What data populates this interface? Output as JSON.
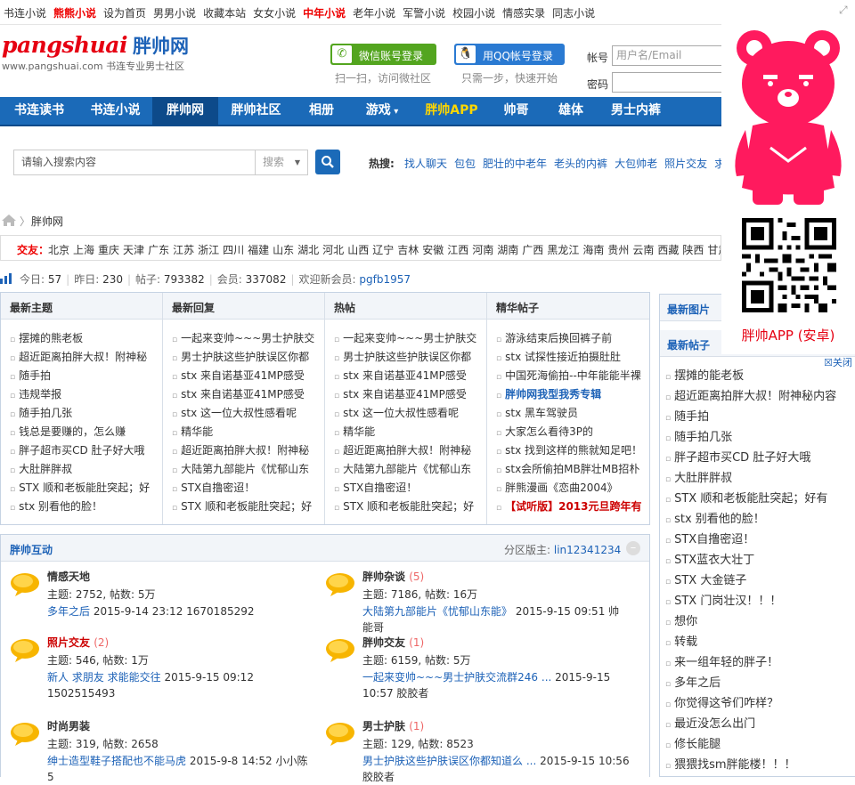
{
  "topbar": {
    "links": [
      {
        "label": "书连小说",
        "hot": false
      },
      {
        "label": "熊熊小说",
        "hot": true
      },
      {
        "label": "设为首页",
        "hot": false
      },
      {
        "label": "男男小说",
        "hot": false
      },
      {
        "label": "收藏本站",
        "hot": false
      },
      {
        "label": "女女小说",
        "hot": false
      },
      {
        "label": "中年小说",
        "hot": true
      },
      {
        "label": "老年小说",
        "hot": false
      },
      {
        "label": "军警小说",
        "hot": false
      },
      {
        "label": "校园小说",
        "hot": false
      },
      {
        "label": "情感实录",
        "hot": false
      },
      {
        "label": "同志小说",
        "hot": false
      }
    ]
  },
  "logo": {
    "brand": "pangshuai",
    "cn": "胖帅网",
    "sub": "www.pangshuai.com  书连专业男士社区"
  },
  "login": {
    "wechat_label": "微信账号登录",
    "wechat_hint": "扫一扫，访问微社区",
    "qq_label": "用QQ帐号登录",
    "qq_hint": "只需一步，快速开始",
    "account_label": "帐号",
    "password_label": "密码",
    "account_placeholder": "用户名/Email"
  },
  "nav": [
    "书连读书",
    "书连小说",
    "胖帅网",
    "胖帅社区",
    "相册",
    "游戏",
    "胖帅APP",
    "帅哥",
    "雄体",
    "男士内裤"
  ],
  "search": {
    "placeholder": "请输入搜索内容",
    "type": "搜索",
    "hot_label": "热搜:",
    "hot": [
      "找人聊天",
      "包包",
      "肥壮的中老年",
      "老头的内裤",
      "大包帅老",
      "照片交友",
      "求"
    ]
  },
  "breadcrumb": "胖帅网",
  "areas": {
    "label": "交友：",
    "list": [
      "北京",
      "上海",
      "重庆",
      "天津",
      "广东",
      "江苏",
      "浙江",
      "四川",
      "福建",
      "山东",
      "湖北",
      "河北",
      "山西",
      "辽宁",
      "吉林",
      "安徽",
      "江西",
      "河南",
      "湖南",
      "广西",
      "黑龙江",
      "海南",
      "贵州",
      "云南",
      "西藏",
      "陕西",
      "甘肃"
    ]
  },
  "stats": {
    "today_label": "今日:",
    "today": "57",
    "yesterday_label": "昨日:",
    "yesterday": "230",
    "posts_label": "帖子:",
    "posts": "793382",
    "members_label": "会员:",
    "members": "337082",
    "welcome": "欢迎新会员:",
    "newest": "pgfb1957"
  },
  "columns": [
    {
      "title": "最新主题",
      "items": [
        {
          "t": "摆摊的熊老板"
        },
        {
          "t": "超近距离拍胖大叔！附神秘"
        },
        {
          "t": "随手拍"
        },
        {
          "t": "违规举报"
        },
        {
          "t": "随手拍几张"
        },
        {
          "t": "钱总是要赚的，怎么赚"
        },
        {
          "t": "胖子超市买CD 肚子好大哦"
        },
        {
          "t": "大肚胖胖叔"
        },
        {
          "t": "STX 顺和老板能肚突起；好"
        },
        {
          "t": "stx 别看他的脸！"
        }
      ]
    },
    {
      "title": "最新回复",
      "items": [
        {
          "t": "一起来变帅~~~男士护肤交"
        },
        {
          "t": "男士护肤这些护肤误区你都"
        },
        {
          "t": "stx 来自诺基亚41MP感受"
        },
        {
          "t": "stx 来自诺基亚41MP感受"
        },
        {
          "t": "stx 这一位大叔性感看呢"
        },
        {
          "t": "精华能"
        },
        {
          "t": "超近距离拍胖大叔！附神秘"
        },
        {
          "t": "大陆第九部能片《忧郁山东"
        },
        {
          "t": "STX自撸密迢！"
        },
        {
          "t": "STX 顺和老板能肚突起；好"
        }
      ]
    },
    {
      "title": "热帖",
      "items": [
        {
          "t": "一起来变帅~~~男士护肤交"
        },
        {
          "t": "男士护肤这些护肤误区你都"
        },
        {
          "t": "stx 来自诺基亚41MP感受"
        },
        {
          "t": "stx 来自诺基亚41MP感受"
        },
        {
          "t": "stx 这一位大叔性感看呢"
        },
        {
          "t": "精华能"
        },
        {
          "t": "超近距离拍胖大叔！附神秘"
        },
        {
          "t": "大陆第九部能片《忧郁山东"
        },
        {
          "t": "STX自撸密迢！"
        },
        {
          "t": "STX 顺和老板能肚突起；好"
        }
      ]
    },
    {
      "title": "精华帖子",
      "items": [
        {
          "t": "游泳结束后换回裤子前"
        },
        {
          "t": "stx 试探性接近拍摄肚肚"
        },
        {
          "t": "中国死海偷拍--中年能能半裸"
        },
        {
          "t": "胖帅网我型我秀专辑",
          "style": "blue"
        },
        {
          "t": "stx 黑车驾驶员"
        },
        {
          "t": "大家怎么看待3P的"
        },
        {
          "t": "stx 找到这样的熊就知足吧！"
        },
        {
          "t": "stx会所偷拍MB胖壮MB招朴"
        },
        {
          "t": "胖熊漫画《恋曲2004》"
        },
        {
          "t": "【试听版】2013元旦跨年有",
          "style": "red"
        }
      ]
    }
  ],
  "forum": {
    "title": "胖帅互动",
    "mod_label": "分区版主:",
    "mod": "lin12341234",
    "boards": [
      {
        "name": "情感天地",
        "new": "",
        "stat": "主题: 2752, 帖数: 5万",
        "last_link": "多年之后",
        "last_info": " 2015-9-14 23:12 1670185292",
        "red": false
      },
      {
        "name": "胖帅杂谈",
        "new": "(5)",
        "stat": "主题: 7186, 帖数: 16万",
        "last_link": "大陆第九部能片《忧郁山东能》",
        "last_info": " 2015-9-15 09:51 帅能哥",
        "red": false
      },
      {
        "name": "照片交友",
        "new": "(2)",
        "stat": "主题: 546, 帖数: 1万",
        "last_link": "新人 求朋友 求能能交往",
        "last_info": " 2015-9-15 09:12 1502515493",
        "red": true
      },
      {
        "name": "胖帅交友",
        "new": "(1)",
        "stat": "主题: 6159, 帖数: 5万",
        "last_link": "一起来变帅~~~男士护肤交流群246 ...",
        "last_info": " 2015-9-15 10:57 胶胶者",
        "red": false
      },
      {
        "name": "时尚男装",
        "new": "",
        "stat": "主题: 319, 帖数: 2658",
        "last_link": "绅士造型鞋子搭配也不能马虎",
        "last_info": " 2015-9-8 14:52 小小陈5",
        "red": false
      },
      {
        "name": "男士护肤",
        "new": "(1)",
        "stat": "主题: 129, 帖数: 8523",
        "last_link": "男士护肤这些护肤误区你都知道么 ...",
        "last_info": " 2015-9-15 10:56 胶胶者",
        "red": false
      }
    ]
  },
  "sidebar": {
    "pics_title": "最新图片",
    "posts_title": "最新帖子",
    "items": [
      "摆摊的能老板",
      "超近距离拍胖大叔！附神秘内容",
      "随手拍",
      "随手拍几张",
      "胖子超市买CD 肚子好大哦",
      "大肚胖胖叔",
      "STX 顺和老板能肚突起；好有",
      "stx 别看他的脸！",
      "STX自撸密迢！",
      "STX蓝衣大壮丁",
      "STX 大金链子",
      "STX 门岗壮汉！！！",
      "想你",
      "转载",
      "来一组年轻的胖子！",
      "多年之后",
      "你觉得这爷们咋样？",
      "最近没怎么出门",
      "修长能腿",
      "猥猥找sm胖能楼！！！"
    ]
  },
  "float_ad": {
    "app_label": "胖帅APP (安卓)",
    "close_label": "关闭"
  },
  "colors": {
    "brand_red": "#e60012",
    "nav_blue": "#1b6ab8",
    "link_blue": "#1d62b7",
    "wechat_green": "#53a51f"
  }
}
